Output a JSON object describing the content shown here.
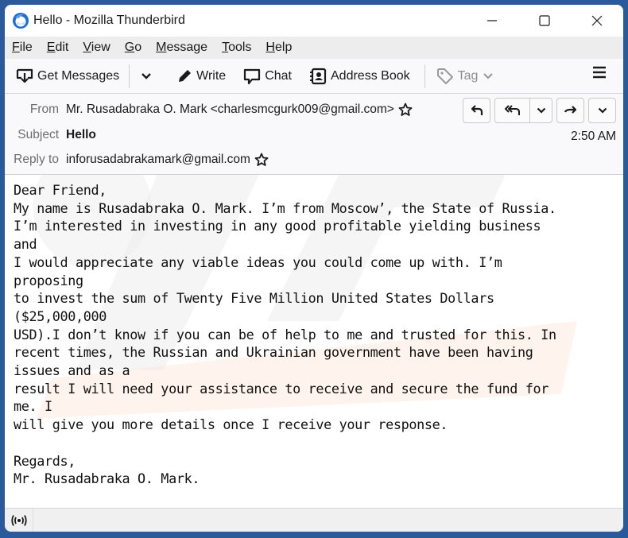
{
  "window": {
    "title": "Hello - Mozilla Thunderbird",
    "controls": [
      "minimize",
      "maximize",
      "close"
    ]
  },
  "menubar": {
    "items": [
      {
        "label": "File",
        "accel": "F",
        "rest": "ile"
      },
      {
        "label": "Edit",
        "accel": "E",
        "rest": "dit"
      },
      {
        "label": "View",
        "accel": "V",
        "rest": "iew"
      },
      {
        "label": "Go",
        "accel": "G",
        "rest": "o"
      },
      {
        "label": "Message",
        "accel": "M",
        "rest": "essage"
      },
      {
        "label": "Tools",
        "accel": "T",
        "rest": "ools"
      },
      {
        "label": "Help",
        "accel": "H",
        "rest": "elp"
      }
    ]
  },
  "toolbar": {
    "get_messages": "Get Messages",
    "write": "Write",
    "chat": "Chat",
    "address_book": "Address Book",
    "tag": "Tag"
  },
  "header": {
    "from_label": "From",
    "from_value": "Mr. Rusadabraka O. Mark <charlesmcgurk009@gmail.com>",
    "subject_label": "Subject",
    "subject_value": "Hello",
    "reply_to_label": "Reply to",
    "reply_to_value": "inforusadabrakamark@gmail.com",
    "time": "2:50 AM",
    "actions": [
      "reply",
      "reply-all",
      "reply-all-menu",
      "forward",
      "more"
    ]
  },
  "body": {
    "lines": [
      "Dear Friend,",
      "My name is Rusadabraka O. Mark. I’m from Moscow’, the State of Russia.",
      "I’m interested in investing in any good profitable yielding business",
      "and",
      "I would appreciate any viable ideas you could come up with. I’m",
      "proposing",
      "to invest the sum of Twenty Five Million United States Dollars",
      "($25,000,000",
      "USD).I don’t know if you can be of help to me and trusted for this. In",
      "recent times, the Russian and Ukrainian government have been having",
      "issues and as a",
      "result I will need your assistance to receive and secure the fund for",
      "me. I",
      "will give you more details once I receive your response.",
      "",
      "Regards,",
      "Mr. Rusadabraka O. Mark."
    ]
  },
  "colors": {
    "window_frame": "#2a5a9a",
    "menubar_bg": "#ededed",
    "toolbar_bg": "#f9f9fb",
    "watermark_gray": "#ececec",
    "watermark_orange": "#fde3d0"
  }
}
